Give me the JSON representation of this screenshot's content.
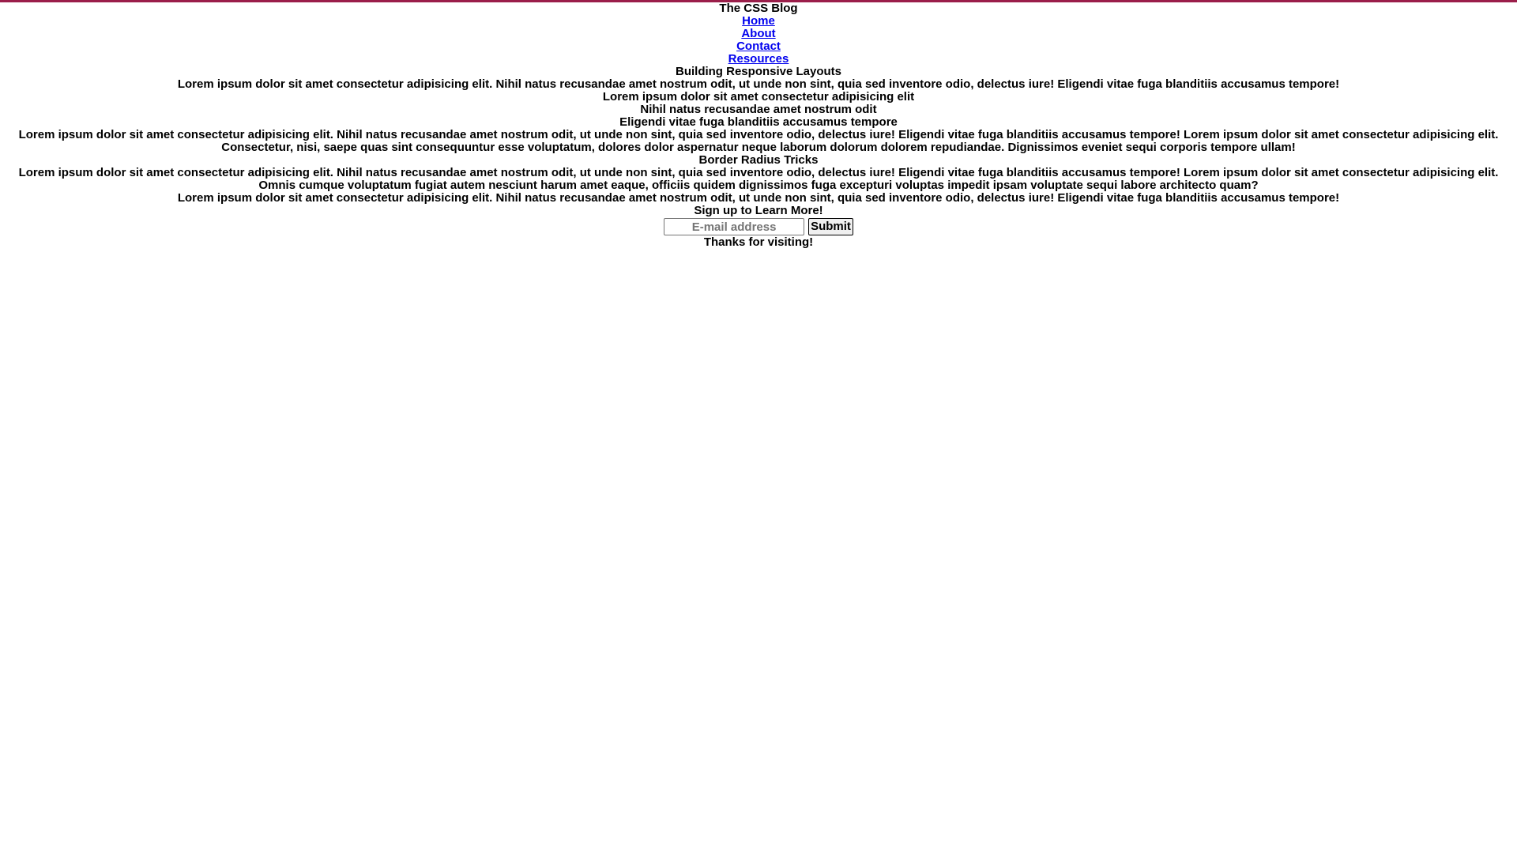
{
  "colors": {
    "top_rule": "#9b1e4a",
    "link": "#0000ee",
    "text": "#000000",
    "background": "#ffffff"
  },
  "header": {
    "site_title": "The CSS Blog"
  },
  "nav": {
    "items": [
      {
        "label": "Home"
      },
      {
        "label": "About"
      },
      {
        "label": "Contact"
      },
      {
        "label": "Resources"
      }
    ]
  },
  "article1": {
    "title": "Building Responsive Layouts",
    "intro": "Lorem ipsum dolor sit amet consectetur adipisicing elit. Nihil natus recusandae amet nostrum odit, ut unde non sint, quia sed inventore odio, delectus iure! Eligendi vitae fuga blanditiis accusamus tempore!",
    "subheadings": [
      "Lorem ipsum dolor sit amet consectetur adipisicing elit",
      "Nihil natus recusandae amet nostrum odit",
      "Eligendi vitae fuga blanditiis accusamus tempore"
    ],
    "body": "Lorem ipsum dolor sit amet consectetur adipisicing elit. Nihil natus recusandae amet nostrum odit, ut unde non sint, quia sed inventore odio, delectus iure! Eligendi vitae fuga blanditiis accusamus tempore! Lorem ipsum dolor sit amet consectetur adipisicing elit. Consectetur, nisi, saepe quas sint consequuntur esse voluptatum, dolores dolor aspernatur neque laborum dolorum dolorem repudiandae. Dignissimos eveniet sequi corporis tempore ullam!"
  },
  "article2": {
    "title": "Border Radius Tricks",
    "body": "Lorem ipsum dolor sit amet consectetur adipisicing elit. Nihil natus recusandae amet nostrum odit, ut unde non sint, quia sed inventore odio, delectus iure! Eligendi vitae fuga blanditiis accusamus tempore! Lorem ipsum dolor sit amet consectetur adipisicing elit. Omnis cumque voluptatum fugiat autem nesciunt harum amet eaque, officiis quidem dignissimos fuga excepturi voluptas impedit ipsam voluptate sequi labore architecto quam?"
  },
  "aside": {
    "text": "Lorem ipsum dolor sit amet consectetur adipisicing elit. Nihil natus recusandae amet nostrum odit, ut unde non sint, quia sed inventore odio, delectus iure! Eligendi vitae fuga blanditiis accusamus tempore!"
  },
  "signup": {
    "heading": "Sign up to Learn More!",
    "email_placeholder": "E-mail address",
    "email_value": "",
    "submit_label": "Submit"
  },
  "footer": {
    "text": "Thanks for visiting!"
  }
}
